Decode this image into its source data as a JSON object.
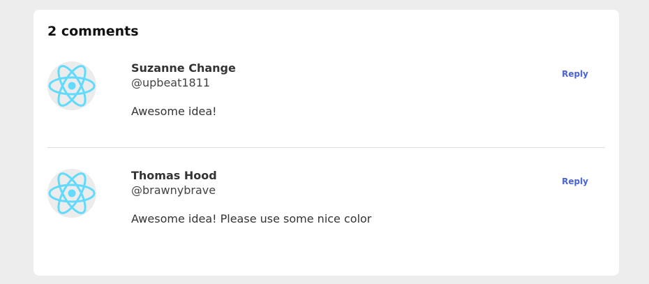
{
  "comments_heading": "2 comments",
  "colors": {
    "accent": "#4a62d4",
    "avatar_logo": "#61dafb"
  },
  "comments": [
    {
      "author": "Suzanne Change",
      "handle": "@upbeat1811",
      "text": "Awesome idea!",
      "reply_label": "Reply",
      "avatar_icon": "react-logo-icon"
    },
    {
      "author": "Thomas Hood",
      "handle": "@brawnybrave",
      "text": "Awesome idea! Please use some nice color",
      "reply_label": "Reply",
      "avatar_icon": "react-logo-icon"
    }
  ]
}
